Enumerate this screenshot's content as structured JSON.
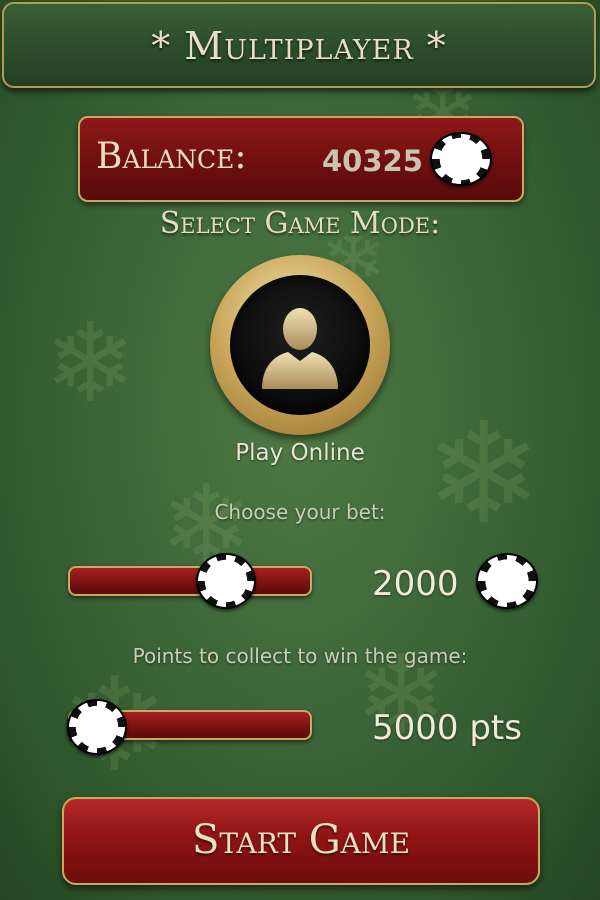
{
  "header": {
    "title": "* Multiplayer *"
  },
  "balance": {
    "label": "Balance:",
    "value": "40325",
    "icon": "poker-chip-icon"
  },
  "game_mode": {
    "label": "Select Game Mode:",
    "option_label": "Play Online",
    "icon": "user-silhouette-icon"
  },
  "bet": {
    "label": "Choose your bet:",
    "value": "2000",
    "icon": "poker-chip-icon",
    "slider_fraction": 0.6
  },
  "points": {
    "label": "Points to collect to win the game:",
    "value": "5000 pts",
    "slider_fraction": 0.0
  },
  "start_button": {
    "label": "Start Game"
  },
  "colors": {
    "felt_green": "#3c6638",
    "accent_gold": "#c9a860",
    "accent_red": "#8f1414",
    "text_cream": "#eadfc0"
  }
}
